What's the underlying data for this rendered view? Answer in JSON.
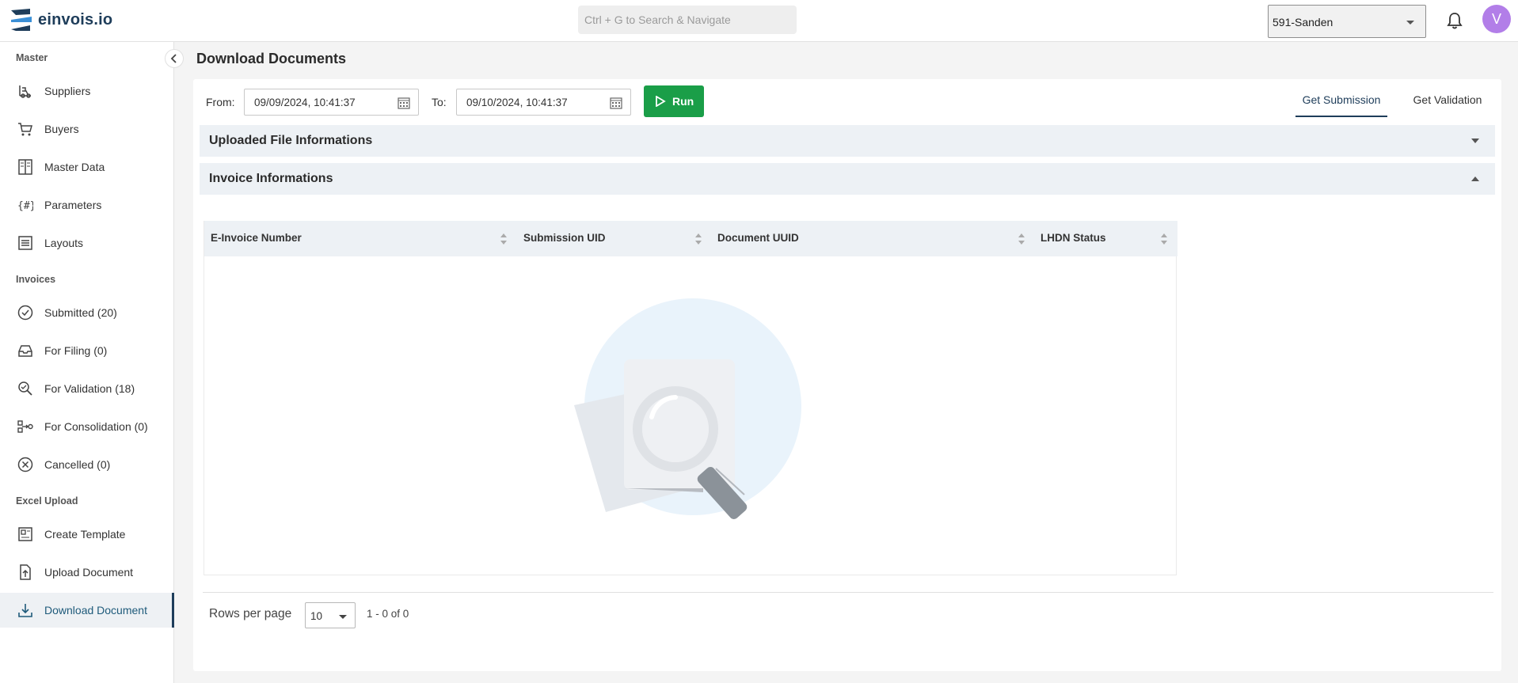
{
  "app": {
    "logo_text": "einvois.io"
  },
  "header": {
    "search_placeholder": "Ctrl + G to Search & Navigate",
    "org_selected": "591-Sanden",
    "avatar_initial": "V"
  },
  "sidebar": {
    "sections": [
      {
        "label": "Master"
      },
      {
        "label": "Invoices"
      },
      {
        "label": "Excel Upload"
      }
    ],
    "items": [
      {
        "label": "Suppliers",
        "icon": "forklift-icon"
      },
      {
        "label": "Buyers",
        "icon": "cart-icon"
      },
      {
        "label": "Master Data",
        "icon": "master-data-icon"
      },
      {
        "label": "Parameters",
        "icon": "braces-hash-icon"
      },
      {
        "label": "Layouts",
        "icon": "layout-icon"
      },
      {
        "label": "Submitted (20)",
        "icon": "check-circle-icon"
      },
      {
        "label": "For Filing (0)",
        "icon": "inbox-icon"
      },
      {
        "label": "For Validation (18)",
        "icon": "search-check-icon"
      },
      {
        "label": "For Consolidation (0)",
        "icon": "consolidate-icon"
      },
      {
        "label": "Cancelled (0)",
        "icon": "x-circle-icon"
      },
      {
        "label": "Create Template",
        "icon": "template-icon"
      },
      {
        "label": "Upload Document",
        "icon": "upload-file-icon"
      },
      {
        "label": "Download Document",
        "icon": "download-icon",
        "active": true
      }
    ]
  },
  "main": {
    "title": "Download Documents",
    "from_label": "From:",
    "from_value": "09/09/2024, 10:41:37",
    "to_label": "To:",
    "to_value": "09/10/2024, 10:41:37",
    "run_label": "Run",
    "tabs": [
      {
        "label": "Get Submission",
        "active": true
      },
      {
        "label": "Get Validation",
        "active": false
      }
    ],
    "accordions": [
      {
        "title": "Uploaded File Informations",
        "expanded": false
      },
      {
        "title": "Invoice Informations",
        "expanded": true
      }
    ],
    "table": {
      "columns": [
        "E-Invoice Number",
        "Submission UID",
        "Document UUID",
        "LHDN Status"
      ],
      "rows": []
    },
    "pagination": {
      "rows_per_page_label": "Rows per page",
      "rows_per_page_value": "10",
      "range_text": "1 - 0 of 0"
    }
  },
  "colors": {
    "brand": "#1e3d5a",
    "run_button": "#1a9e48",
    "avatar": "#b27ee8",
    "accordion_bg": "#edf1f5"
  }
}
